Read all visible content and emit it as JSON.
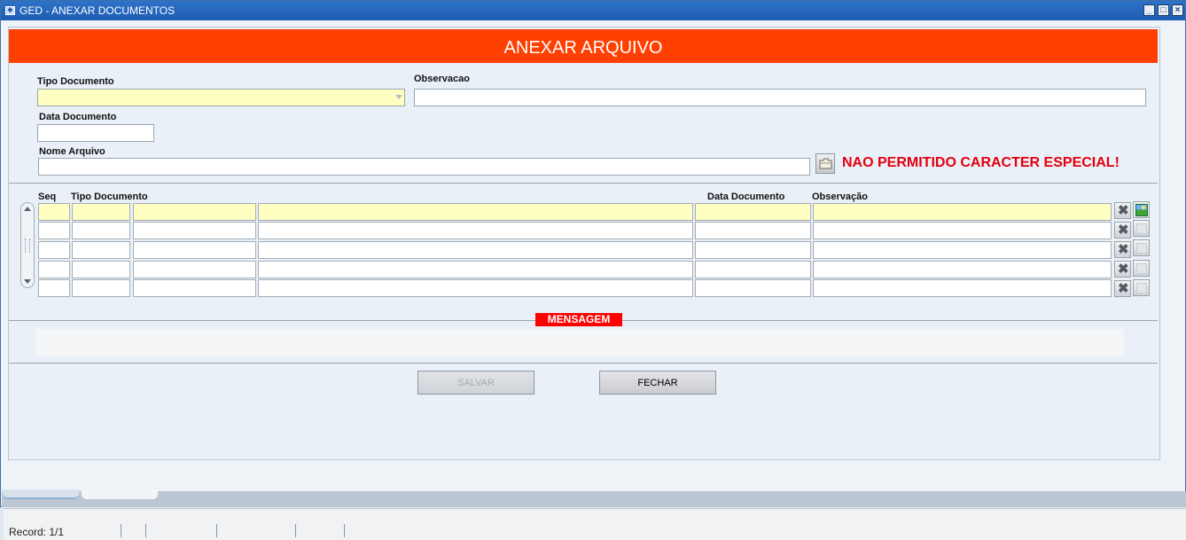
{
  "window": {
    "title": "GED - ANEXAR DOCUMENTOS",
    "minimize_icon": "minimize-icon",
    "maximize_icon": "maximize-icon",
    "close_icon": "close-icon"
  },
  "banner": {
    "title": "ANEXAR ARQUIVO",
    "color": "#ff4000"
  },
  "form": {
    "tipo_documento_label": "Tipo Documento",
    "tipo_documento_value": "",
    "observacao_label": "Observacao",
    "observacao_value": "",
    "data_documento_label": "Data Documento",
    "data_documento_value": "",
    "nome_arquivo_label": "Nome Arquivo",
    "nome_arquivo_value": "",
    "browse_icon": "folder-icon",
    "warning": "NAO PERMITIDO CARACTER ESPECIAL!",
    "warning_color": "#e4000f",
    "input_highlight_color": "#ffffc2"
  },
  "grid": {
    "headers": {
      "seq": "Seq",
      "tipo_documento": "Tipo Documento",
      "data_documento": "Data Documento",
      "observacao": "Observação"
    },
    "rows": [
      {
        "seq": "",
        "col2": "",
        "col3": "",
        "tipo_documento": "",
        "data_documento": "",
        "observacao": "",
        "active": true
      },
      {
        "seq": "",
        "col2": "",
        "col3": "",
        "tipo_documento": "",
        "data_documento": "",
        "observacao": "",
        "active": false
      },
      {
        "seq": "",
        "col2": "",
        "col3": "",
        "tipo_documento": "",
        "data_documento": "",
        "observacao": "",
        "active": false
      },
      {
        "seq": "",
        "col2": "",
        "col3": "",
        "tipo_documento": "",
        "data_documento": "",
        "observacao": "",
        "active": false
      },
      {
        "seq": "",
        "col2": "",
        "col3": "",
        "tipo_documento": "",
        "data_documento": "",
        "observacao": "",
        "active": false
      }
    ],
    "delete_icon": "delete-x-icon",
    "view_icon": "image-icon"
  },
  "message": {
    "label": "MENSAGEM",
    "text": "",
    "color": "#ff0000"
  },
  "buttons": {
    "salvar": "SALVAR",
    "fechar": "FECHAR"
  },
  "status": {
    "record": "Record: 1/1"
  }
}
